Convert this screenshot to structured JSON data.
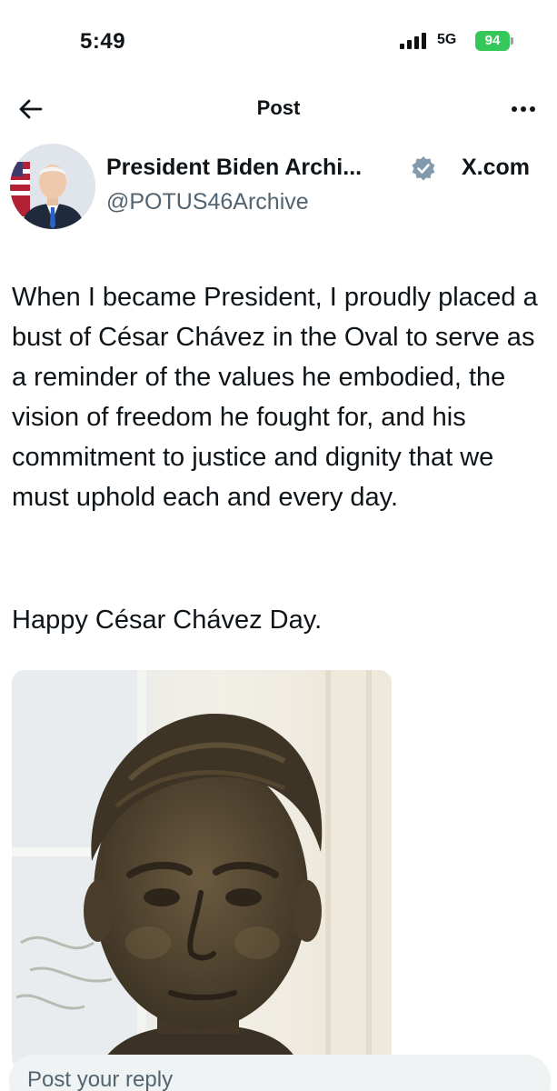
{
  "status_bar": {
    "time": "5:49",
    "network": "5G",
    "battery": "94"
  },
  "nav": {
    "title": "Post"
  },
  "author": {
    "name": "President Biden Archi...",
    "handle": "@POTUS46Archive",
    "source_label": "X.com",
    "verified_color": "#829aab"
  },
  "post": {
    "body": "When I became President, I proudly placed a bust of César Chávez in the Oval to serve as a reminder of the values he embodied, the vision of freedom he fought for, and his commitment to justice and dignity that we must uphold each and every day.",
    "closing": "Happy César Chávez Day."
  },
  "media": {
    "icon": "bronze-bust-photo"
  },
  "reply": {
    "placeholder": "Post your reply"
  },
  "colors": {
    "text": "#0f1419",
    "secondary_text": "#536471",
    "battery": "#34c759",
    "reply_bg": "#eff3f4"
  }
}
